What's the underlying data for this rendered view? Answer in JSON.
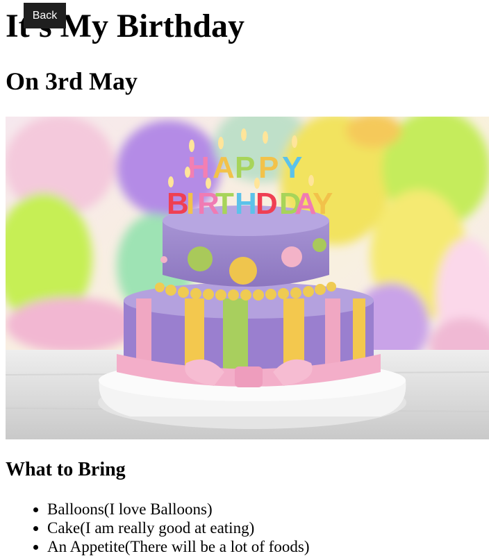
{
  "nav": {
    "back_label": "Back"
  },
  "page": {
    "title": "It's My Birthday",
    "subtitle": "On 3rd May"
  },
  "hero_image": {
    "icon": "birthday-cake-image",
    "topper_line1": "HAPPY",
    "topper_line2": "BIRTHDAY",
    "colors": {
      "cake_top": "#9b86c9",
      "cake_stripes_yellow": "#f0c84a",
      "cake_stripes_green": "#a8cf5e",
      "ribbon_pink": "#f3aec9",
      "balloon_purple": "#b58de6",
      "balloon_green": "#c6ee5a",
      "balloon_yellow": "#f3e660"
    }
  },
  "bring": {
    "heading": "What to Bring",
    "items": [
      "Balloons(I love Balloons)",
      "Cake(I am really good at eating)",
      "An Appetite(There will be a lot of foods)"
    ]
  }
}
